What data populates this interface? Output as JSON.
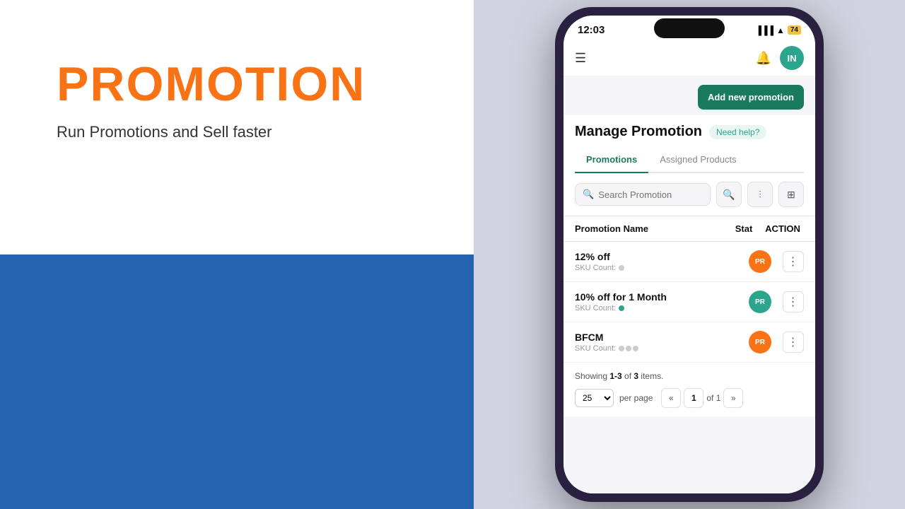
{
  "left": {
    "title": "PROMOTION",
    "subtitle": "Run Promotions and Sell faster"
  },
  "phone": {
    "statusBar": {
      "time": "12:03",
      "battery": "74",
      "icons": "▐▐▐ ▲"
    },
    "header": {
      "avatarText": "IN"
    },
    "topBar": {
      "addButton": "Add new promotion"
    },
    "manage": {
      "title": "Manage Promotion",
      "helpBadge": "Need help?"
    },
    "tabs": [
      {
        "label": "Promotions",
        "active": true
      },
      {
        "label": "Assigned Products",
        "active": false
      }
    ],
    "search": {
      "placeholder": "Search Promotion"
    },
    "tableHeader": {
      "name": "Promotion Name",
      "status": "Stat",
      "action": "ACTION"
    },
    "rows": [
      {
        "name": "12% off",
        "sku": "SKU Count:",
        "statusBadge": "PR",
        "statusColor": "orange"
      },
      {
        "name": "10% off for 1 Month",
        "sku": "SKU Count:",
        "statusBadge": "PR",
        "statusColor": "green"
      },
      {
        "name": "BFCM",
        "sku": "SKU Count:",
        "statusBadge": "PR",
        "statusColor": "orange"
      }
    ],
    "pagination": {
      "showing": "Showing ",
      "range": "1-3",
      "of": "of",
      "total": "3",
      "items": "items.",
      "perPage": "25",
      "pageCurrent": "1",
      "pageOf": "of 1"
    }
  }
}
